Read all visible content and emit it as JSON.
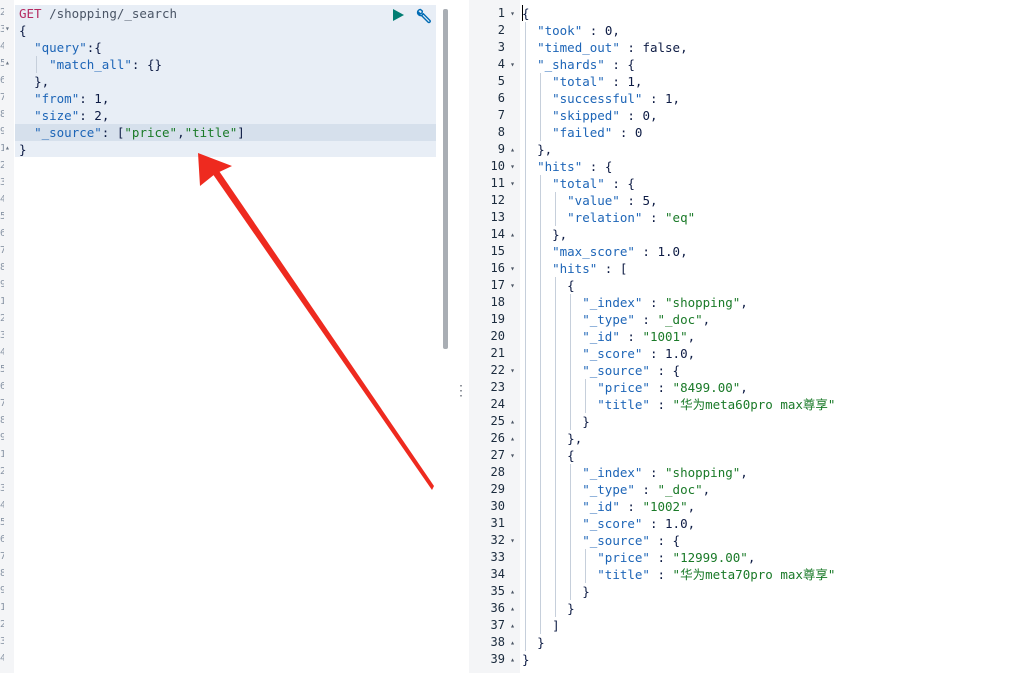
{
  "request": {
    "method": "GET",
    "path": "/shopping/_search",
    "lines": [
      "{",
      "  \"query\":{",
      "    \"match_all\": {}",
      "  },",
      "  \"from\": 1,",
      "  \"size\": 2,",
      "  \"_source\": [\"price\",\"title\"]",
      "}"
    ]
  },
  "toolbar": {
    "run_icon": "play-icon",
    "settings_icon": "wrench-icon",
    "run_color": "#017d73",
    "settings_color": "#006bb4"
  },
  "left_gutter": {
    "visible_fragments": [
      "1",
      "2",
      "3",
      "4",
      "5",
      "6",
      "7",
      "8",
      "9"
    ]
  },
  "splitter": {
    "glyph": "⋮"
  },
  "response": {
    "line_numbers": [
      "1",
      "2",
      "3",
      "4",
      "5",
      "6",
      "7",
      "8",
      "9",
      "10",
      "11",
      "12",
      "13",
      "14",
      "15",
      "16",
      "17",
      "18",
      "19",
      "20",
      "21",
      "22",
      "23",
      "24",
      "25",
      "26",
      "27",
      "28",
      "29",
      "30",
      "31",
      "32",
      "33",
      "34",
      "35",
      "36",
      "37",
      "38",
      "39"
    ],
    "lines": [
      "{",
      "  \"took\" : 0,",
      "  \"timed_out\" : false,",
      "  \"_shards\" : {",
      "    \"total\" : 1,",
      "    \"successful\" : 1,",
      "    \"skipped\" : 0,",
      "    \"failed\" : 0",
      "  },",
      "  \"hits\" : {",
      "    \"total\" : {",
      "      \"value\" : 5,",
      "      \"relation\" : \"eq\"",
      "    },",
      "    \"max_score\" : 1.0,",
      "    \"hits\" : [",
      "      {",
      "        \"_index\" : \"shopping\",",
      "        \"_type\" : \"_doc\",",
      "        \"_id\" : \"1001\",",
      "        \"_score\" : 1.0,",
      "        \"_source\" : {",
      "          \"price\" : \"8499.00\",",
      "          \"title\" : \"华为meta60pro max尊享\"",
      "        }",
      "      },",
      "      {",
      "        \"_index\" : \"shopping\",",
      "        \"_type\" : \"_doc\",",
      "        \"_id\" : \"1002\",",
      "        \"_score\" : 1.0,",
      "        \"_source\" : {",
      "          \"price\" : \"12999.00\",",
      "          \"title\" : \"华为meta70pro max尊享\"",
      "        }",
      "      }",
      "    ]",
      "  }",
      "}"
    ],
    "fold_markers": {
      "1": "▾",
      "4": "▾",
      "9": "▴",
      "10": "▾",
      "11": "▾",
      "14": "▴",
      "16": "▾",
      "17": "▾",
      "22": "▾",
      "25": "▴",
      "26": "▴",
      "27": "▾",
      "32": "▾",
      "35": "▴",
      "36": "▴",
      "37": "▴",
      "38": "▴",
      "39": "▴"
    }
  },
  "colors": {
    "key": "#1d65b7",
    "string": "#1a7a28",
    "method": "#b62b61",
    "annotation_arrow": "#ee2a1f"
  }
}
